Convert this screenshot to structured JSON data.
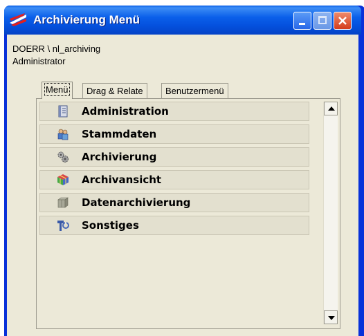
{
  "window": {
    "title": "Archivierung Menü",
    "buttons": [
      "minimize",
      "maximize",
      "close"
    ]
  },
  "user": {
    "domain_user": "DOERR \\ nl_archiving",
    "role": "Administrator"
  },
  "tabs": [
    {
      "label": "Menü",
      "active": true
    },
    {
      "label": "Drag & Relate",
      "active": false
    },
    {
      "label": "Benutzermenü",
      "active": false
    }
  ],
  "menu": {
    "items": [
      {
        "label": "Administration",
        "icon": "document-icon"
      },
      {
        "label": "Stammdaten",
        "icon": "users-icon"
      },
      {
        "label": "Archivierung",
        "icon": "gears-icon"
      },
      {
        "label": "Archivansicht",
        "icon": "cube-icon"
      },
      {
        "label": "Datenarchivierung",
        "icon": "box-icon"
      },
      {
        "label": "Sonstiges",
        "icon": "tools-icon"
      }
    ]
  },
  "colors": {
    "titlebar": "#0450dd",
    "client": "#ece9d8",
    "close_button": "#d43c1c"
  }
}
